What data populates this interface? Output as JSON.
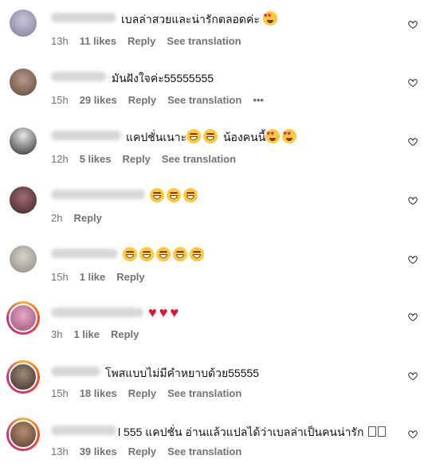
{
  "comments": [
    {
      "text": "เบลล่าสวยและน่ารักตลอดค่ะ",
      "time": "13h",
      "likes": "11 likes",
      "reply": "Reply",
      "translate": "See translation"
    },
    {
      "text": "มันฝังใจค่ะ55555555",
      "time": "15h",
      "likes": "29 likes",
      "reply": "Reply",
      "translate": "See translation",
      "more": "•••"
    },
    {
      "text": "แคปชั่นเนาะ",
      "text2": "น้องคนนี้",
      "time": "12h",
      "likes": "5 likes",
      "reply": "Reply",
      "translate": "See translation"
    },
    {
      "text": "",
      "time": "2h",
      "reply": "Reply"
    },
    {
      "text": "",
      "time": "15h",
      "likes": "1 like",
      "reply": "Reply"
    },
    {
      "text": "",
      "time": "3h",
      "likes": "1 like",
      "reply": "Reply"
    },
    {
      "text": "โพสแบบไม่มีคำหยาบด้วย55555",
      "time": "15h",
      "likes": "18 likes",
      "reply": "Reply",
      "translate": "See translation"
    },
    {
      "text": "l 555 แคปชั่น อ่านแล้วแปลได้ว่าเบลล่าเป็นคนน่ารัก",
      "time": "13h",
      "likes": "39 likes",
      "reply": "Reply",
      "translate": "See translation"
    }
  ],
  "icons": {
    "like": "heart-outline-icon",
    "more": "more-dots-icon"
  },
  "colors": {
    "meta": "#737373",
    "text": "#111111",
    "heart": "#e0142b"
  }
}
